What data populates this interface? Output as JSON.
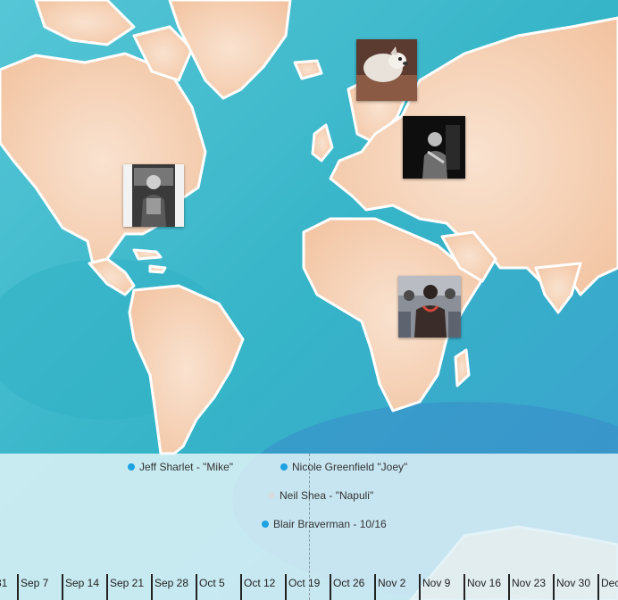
{
  "colors": {
    "ocean": "#4fbfd0",
    "land": "#f4cdb0",
    "coast": "#ffffff",
    "dot_active": "#1da1e0",
    "dot_inactive": "#d6dde0"
  },
  "markers": [
    {
      "name": "marker-jeff-sharlet",
      "icon": "photo-portrait"
    },
    {
      "name": "marker-nicole-greenfield",
      "icon": "photo-dog"
    },
    {
      "name": "marker-neil-shea",
      "icon": "photo-group"
    },
    {
      "name": "marker-blair-braverman",
      "icon": "photo-person"
    }
  ],
  "timeline": {
    "events": [
      {
        "label": "Jeff Sharlet - \"Mike\"",
        "active": true
      },
      {
        "label": "Nicole Greenfield \"Joey\"",
        "active": true
      },
      {
        "label": "Neil Shea - \"Napuli\"",
        "active": false
      },
      {
        "label": "Blair Braverman - 10/16",
        "active": true
      }
    ],
    "ticks": [
      "31",
      "Sep 7",
      "Sep 14",
      "Sep 21",
      "Sep 28",
      "Oct 5",
      "Oct 12",
      "Oct 19",
      "Oct 26",
      "Nov 2",
      "Nov 9",
      "Nov 16",
      "Nov 23",
      "Nov 30",
      "Dec"
    ]
  }
}
